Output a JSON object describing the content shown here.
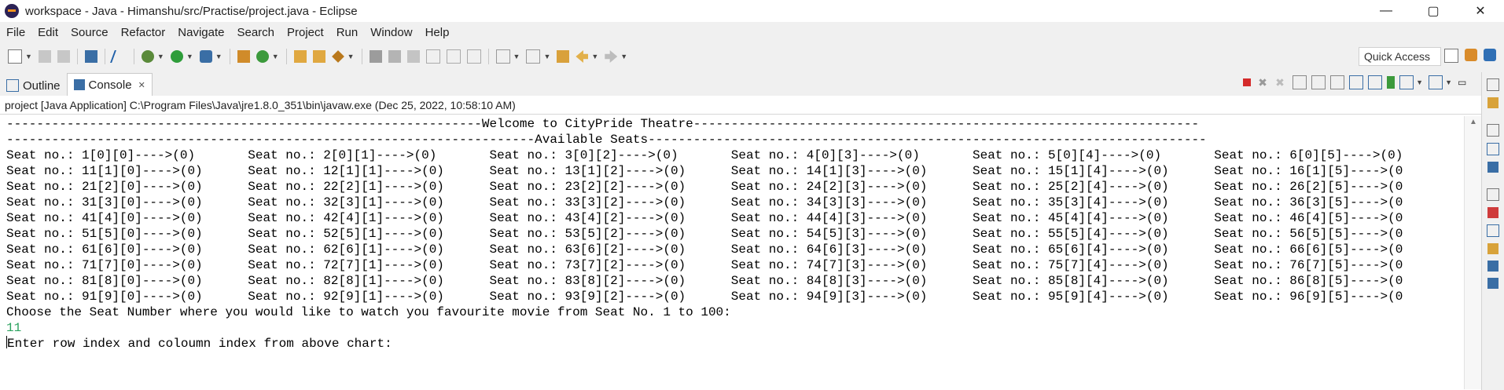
{
  "window": {
    "title": "workspace - Java - Himanshu/src/Practise/project.java - Eclipse",
    "controls": {
      "minimize": "—",
      "maximize": "▢",
      "close": "✕"
    }
  },
  "menu": [
    "File",
    "Edit",
    "Source",
    "Refactor",
    "Navigate",
    "Search",
    "Project",
    "Run",
    "Window",
    "Help"
  ],
  "toolbar": {
    "quick_access": "Quick Access"
  },
  "tabs": {
    "outline": "Outline",
    "console": "Console"
  },
  "console": {
    "launch": "project [Java Application] C:\\Program Files\\Java\\jre1.8.0_351\\bin\\javaw.exe (Dec 25, 2022, 10:58:10 AM)",
    "lines": [
      "---------------------------------------------------------------Welcome to CityPride Theatre-------------------------------------------------------------------",
      "----------------------------------------------------------------------Available Seats--------------------------------------------------------------------------",
      "Seat no.: 1[0][0]---->(0)       Seat no.: 2[0][1]---->(0)       Seat no.: 3[0][2]---->(0)       Seat no.: 4[0][3]---->(0)       Seat no.: 5[0][4]---->(0)       Seat no.: 6[0][5]---->(0)",
      "Seat no.: 11[1][0]---->(0)      Seat no.: 12[1][1]---->(0)      Seat no.: 13[1][2]---->(0)      Seat no.: 14[1][3]---->(0)      Seat no.: 15[1][4]---->(0)      Seat no.: 16[1][5]---->(0",
      "Seat no.: 21[2][0]---->(0)      Seat no.: 22[2][1]---->(0)      Seat no.: 23[2][2]---->(0)      Seat no.: 24[2][3]---->(0)      Seat no.: 25[2][4]---->(0)      Seat no.: 26[2][5]---->(0",
      "Seat no.: 31[3][0]---->(0)      Seat no.: 32[3][1]---->(0)      Seat no.: 33[3][2]---->(0)      Seat no.: 34[3][3]---->(0)      Seat no.: 35[3][4]---->(0)      Seat no.: 36[3][5]---->(0",
      "Seat no.: 41[4][0]---->(0)      Seat no.: 42[4][1]---->(0)      Seat no.: 43[4][2]---->(0)      Seat no.: 44[4][3]---->(0)      Seat no.: 45[4][4]---->(0)      Seat no.: 46[4][5]---->(0",
      "Seat no.: 51[5][0]---->(0)      Seat no.: 52[5][1]---->(0)      Seat no.: 53[5][2]---->(0)      Seat no.: 54[5][3]---->(0)      Seat no.: 55[5][4]---->(0)      Seat no.: 56[5][5]---->(0",
      "Seat no.: 61[6][0]---->(0)      Seat no.: 62[6][1]---->(0)      Seat no.: 63[6][2]---->(0)      Seat no.: 64[6][3]---->(0)      Seat no.: 65[6][4]---->(0)      Seat no.: 66[6][5]---->(0",
      "Seat no.: 71[7][0]---->(0)      Seat no.: 72[7][1]---->(0)      Seat no.: 73[7][2]---->(0)      Seat no.: 74[7][3]---->(0)      Seat no.: 75[7][4]---->(0)      Seat no.: 76[7][5]---->(0",
      "Seat no.: 81[8][0]---->(0)      Seat no.: 82[8][1]---->(0)      Seat no.: 83[8][2]---->(0)      Seat no.: 84[8][3]---->(0)      Seat no.: 85[8][4]---->(0)      Seat no.: 86[8][5]---->(0",
      "Seat no.: 91[9][0]---->(0)      Seat no.: 92[9][1]---->(0)      Seat no.: 93[9][2]---->(0)      Seat no.: 94[9][3]---->(0)      Seat no.: 95[9][4]---->(0)      Seat no.: 96[9][5]---->(0",
      "Choose the Seat Number where you would like to watch you favourite movie from Seat No. 1 to 100:"
    ],
    "input_value": "11",
    "prompt": "Enter row index and coloumn index from above chart:"
  }
}
